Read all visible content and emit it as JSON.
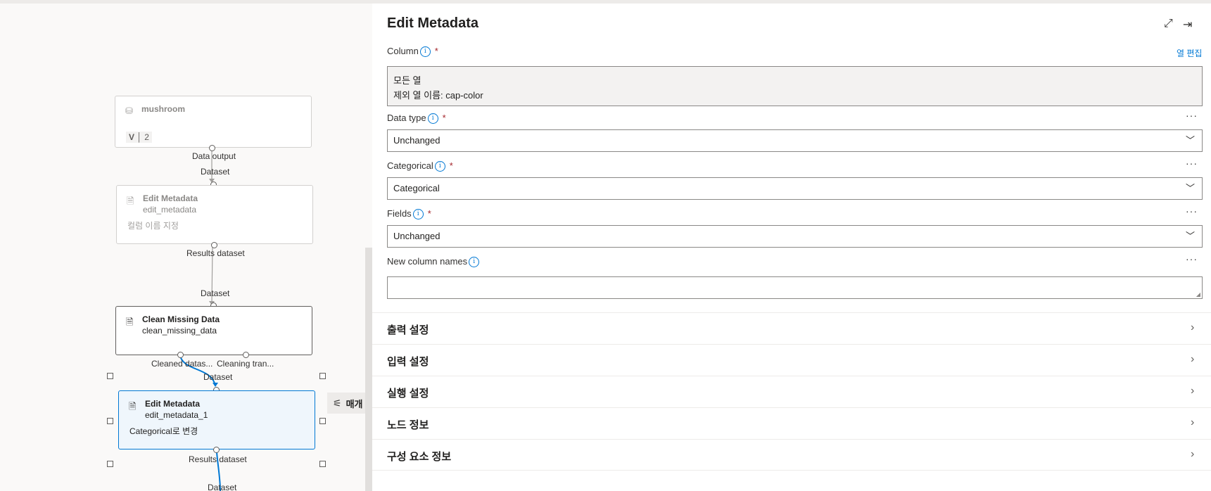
{
  "canvas": {
    "nodes": {
      "dataset": {
        "name": "mushroom",
        "version_prefix": "V",
        "version": "2",
        "output_port": "Data output"
      },
      "edit_metadata": {
        "title": "Edit Metadata",
        "subtitle": "edit_metadata",
        "description": "컬럼 이름 지정",
        "input_port": "Dataset",
        "output_port": "Results dataset"
      },
      "clean_missing": {
        "title": "Clean Missing Data",
        "subtitle": "clean_missing_data",
        "input_port": "Dataset",
        "output_port_1": "Cleaned datas...",
        "output_port_2": "Cleaning tran..."
      },
      "edit_metadata_1": {
        "title": "Edit Metadata",
        "subtitle": "edit_metadata_1",
        "description": "Categorical로 변경",
        "input_port": "Dataset",
        "output_port": "Results dataset"
      },
      "next": {
        "input_port": "Dataset"
      }
    },
    "params_tab_label": "매개"
  },
  "panel": {
    "title": "Edit Metadata",
    "expand_icon": "expand-icon",
    "close_panel_icon": "collapse-panel-icon",
    "column": {
      "label": "Column",
      "required": "*",
      "edit_link": "열 편집",
      "value_line1": "모든 열",
      "value_line2": "제외 열 이름: cap-color"
    },
    "data_type": {
      "label": "Data type",
      "required": "*",
      "value": "Unchanged"
    },
    "categorical": {
      "label": "Categorical",
      "required": "*",
      "value": "Categorical"
    },
    "fields": {
      "label": "Fields",
      "required": "*",
      "value": "Unchanged"
    },
    "new_column_names": {
      "label": "New column names",
      "value": ""
    },
    "more": "···",
    "sections": [
      "출력 설정",
      "입력 설정",
      "실행 설정",
      "노드 정보",
      "구성 요소 정보"
    ]
  },
  "colors": {
    "accent": "#0078d4",
    "required": "#a4262c",
    "selected_bg": "#eff6fc"
  }
}
